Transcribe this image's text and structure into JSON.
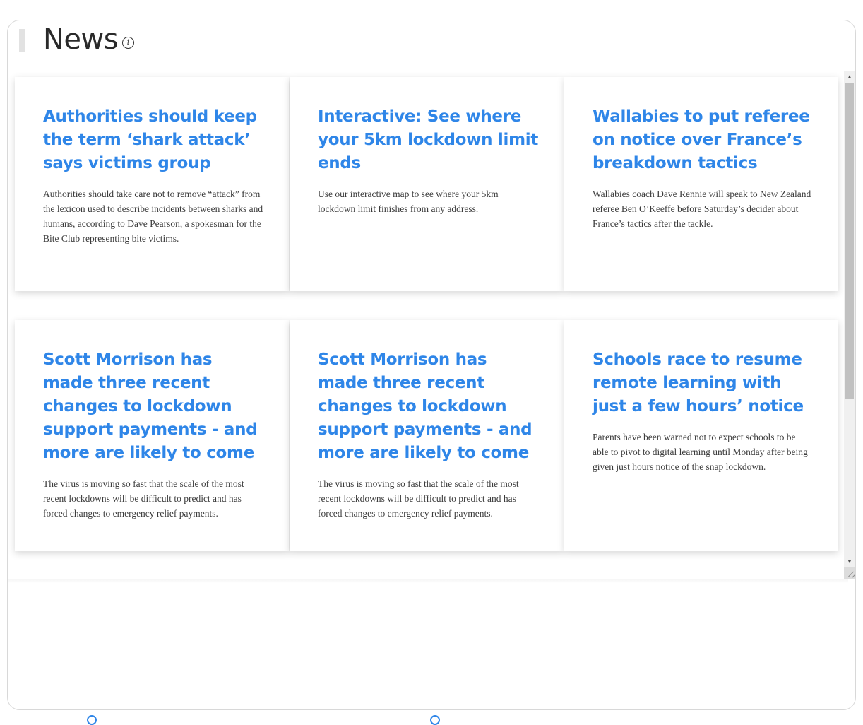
{
  "widget": {
    "title": "News",
    "info_icon": "info-icon"
  },
  "articles": [
    {
      "title": "Authorities should keep the term ‘shark attack’ says victims group",
      "description": "Authorities should take care not to remove “attack” from the lexicon used to describe incidents between sharks and humans, according to Dave Pearson, a spokesman for the Bite Club representing bite victims."
    },
    {
      "title": "Interactive: See where your 5km lockdown limit ends",
      "description": "Use our interactive map to see where your 5km lockdown limit finishes from any address."
    },
    {
      "title": "Wallabies to put referee on notice over France’s breakdown tactics",
      "description": "Wallabies coach Dave Rennie will speak to New Zealand referee Ben O’Keeffe before Saturday’s decider about France’s tactics after the tackle."
    },
    {
      "title": "Scott Morrison has made three recent changes to lockdown support payments - and more are likely to come",
      "description": "The virus is moving so fast that the scale of the most recent lockdowns will be difficult to predict and has forced changes to emergency relief payments."
    },
    {
      "title": "Scott Morrison has made three recent changes to lockdown support payments - and more are likely to come",
      "description": "The virus is moving so fast that the scale of the most recent lockdowns will be difficult to predict and has forced changes to emergency relief payments."
    },
    {
      "title": "Schools race to resume remote learning with just a few hours’ notice",
      "description": "Parents have been warned not to expect schools to be able to pivot to digital learning until Monday after being given just hours notice of the snap lockdown."
    }
  ],
  "scrollbar": {
    "up_glyph": "▲",
    "down_glyph": "▼",
    "position_fraction": 0.0
  },
  "colors": {
    "link": "#2f86e8",
    "text": "#3b3b3b",
    "title": "#2a2a2a"
  }
}
